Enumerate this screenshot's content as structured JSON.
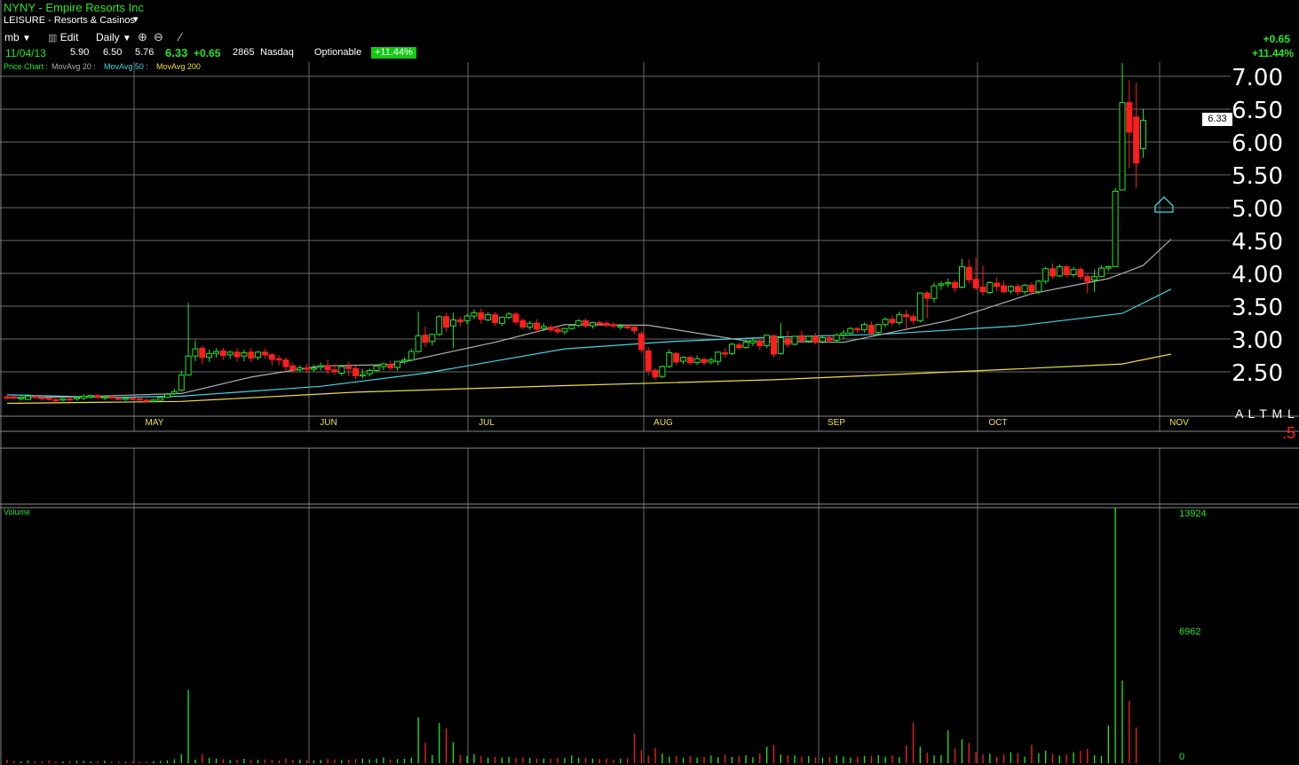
{
  "header": {
    "symbol_title": "NYNY - Empire Resorts Inc",
    "sector": "LEISURE - Resorts & Casinos",
    "sector_arrow": "▾",
    "toolbar": {
      "account": "mb",
      "edit": "Edit",
      "period": "Daily"
    },
    "quote": {
      "date": "11/04/13",
      "open": "5.90",
      "high": "6.50",
      "low": "5.76",
      "close": "6.33",
      "change": "+0.65",
      "volume": "2865",
      "exchange": "Nasdaq",
      "optionable": "Optionable",
      "pct_badge": "+11.44%"
    },
    "legend": {
      "price_chart": "Price Chart :",
      "ma20": "MovAvg 20 :",
      "ma50": "MovAvg 50 :",
      "ma200": "MovAvg 200"
    },
    "right_change": "+0.65",
    "right_pct": "+11.44%"
  },
  "side": {
    "price_tag": "6.33",
    "atml": "A L T M L",
    "point_five": ".5"
  },
  "volume_panel": {
    "label": "Volume"
  },
  "colors": {
    "up": "#22e822",
    "down": "#ff1e1e",
    "grid": "#6a6a6a",
    "ma20": "#b0b0b0",
    "ma50": "#3fd9e6",
    "ma200": "#f0e040",
    "month_label": "#f0e040",
    "volume_label": "#22e822"
  },
  "chart_data": {
    "type": "candlestick",
    "price_axis": {
      "ticks": [
        "7.00",
        "6.50",
        "6.00",
        "5.50",
        "5.00",
        "4.50",
        "4.00",
        "3.50",
        "3.00",
        "2.50"
      ],
      "ylim": [
        2.0,
        7.0
      ]
    },
    "x_axis": {
      "months": [
        "MAY",
        "JUN",
        "JUL",
        "AUG",
        "SEP",
        "OCT",
        "NOV"
      ]
    },
    "volume_axis": {
      "ticks": [
        "13924",
        "6962",
        "0"
      ],
      "ylim": [
        0,
        13924
      ]
    },
    "series": [
      {
        "name": "Price Chart",
        "kind": "candles"
      },
      {
        "name": "MovAvg 20",
        "kind": "line"
      },
      {
        "name": "MovAvg 50",
        "kind": "line"
      },
      {
        "name": "MovAvg 200",
        "kind": "line"
      }
    ],
    "candles": [
      [
        2.12,
        2.14,
        2.1,
        2.08
      ],
      [
        2.12,
        2.14,
        2.1,
        2.08
      ],
      [
        2.1,
        2.13,
        2.11,
        2.06
      ],
      [
        2.08,
        2.16,
        2.13,
        2.07
      ],
      [
        2.13,
        2.15,
        2.11,
        2.09
      ],
      [
        2.11,
        2.12,
        2.09,
        2.06
      ],
      [
        2.1,
        2.12,
        2.08,
        2.06
      ],
      [
        2.08,
        2.1,
        2.06,
        2.04
      ],
      [
        2.07,
        2.1,
        2.09,
        2.05
      ],
      [
        2.09,
        2.11,
        2.08,
        2.06
      ],
      [
        2.09,
        2.13,
        2.11,
        2.06
      ],
      [
        2.1,
        2.16,
        2.13,
        2.07
      ],
      [
        2.12,
        2.15,
        2.14,
        2.09
      ],
      [
        2.14,
        2.16,
        2.11,
        2.09
      ],
      [
        2.1,
        2.13,
        2.12,
        2.07
      ],
      [
        2.12,
        2.14,
        2.1,
        2.09
      ],
      [
        2.1,
        2.12,
        2.08,
        2.07
      ],
      [
        2.08,
        2.11,
        2.1,
        2.06
      ],
      [
        2.1,
        2.12,
        2.09,
        2.07
      ],
      [
        2.09,
        2.11,
        2.07,
        2.06
      ],
      [
        2.07,
        2.08,
        2.06,
        2.04
      ],
      [
        2.06,
        2.08,
        2.07,
        2.05
      ],
      [
        2.07,
        2.12,
        2.11,
        2.06
      ],
      [
        2.11,
        2.18,
        2.16,
        2.1
      ],
      [
        2.17,
        2.24,
        2.2,
        2.15
      ],
      [
        2.22,
        2.52,
        2.45,
        2.2
      ],
      [
        2.45,
        3.55,
        2.74,
        2.44
      ],
      [
        2.74,
        2.98,
        2.85,
        2.66
      ],
      [
        2.86,
        2.9,
        2.72,
        2.62
      ],
      [
        2.72,
        2.84,
        2.78,
        2.65
      ],
      [
        2.78,
        2.86,
        2.81,
        2.72
      ],
      [
        2.82,
        2.87,
        2.75,
        2.68
      ],
      [
        2.76,
        2.82,
        2.8,
        2.7
      ],
      [
        2.8,
        2.86,
        2.73,
        2.66
      ],
      [
        2.74,
        2.84,
        2.79,
        2.66
      ],
      [
        2.8,
        2.86,
        2.71,
        2.65
      ],
      [
        2.72,
        2.82,
        2.8,
        2.68
      ],
      [
        2.8,
        2.85,
        2.76,
        2.7
      ],
      [
        2.76,
        2.79,
        2.69,
        2.6
      ],
      [
        2.7,
        2.75,
        2.68,
        2.6
      ],
      [
        2.68,
        2.72,
        2.58,
        2.52
      ],
      [
        2.59,
        2.64,
        2.53,
        2.48
      ],
      [
        2.53,
        2.6,
        2.56,
        2.5
      ],
      [
        2.56,
        2.62,
        2.55,
        2.48
      ],
      [
        2.55,
        2.61,
        2.56,
        2.5
      ],
      [
        2.57,
        2.64,
        2.59,
        2.52
      ],
      [
        2.59,
        2.68,
        2.53,
        2.46
      ],
      [
        2.53,
        2.61,
        2.5,
        2.45
      ],
      [
        2.48,
        2.58,
        2.58,
        2.44
      ],
      [
        2.58,
        2.65,
        2.55,
        2.44
      ],
      [
        2.55,
        2.62,
        2.44,
        2.39
      ],
      [
        2.45,
        2.54,
        2.46,
        2.4
      ],
      [
        2.47,
        2.55,
        2.52,
        2.43
      ],
      [
        2.52,
        2.61,
        2.59,
        2.5
      ],
      [
        2.58,
        2.64,
        2.62,
        2.53
      ],
      [
        2.61,
        2.67,
        2.56,
        2.52
      ],
      [
        2.57,
        2.66,
        2.66,
        2.52
      ],
      [
        2.66,
        2.72,
        2.68,
        2.62
      ],
      [
        2.68,
        2.85,
        2.81,
        2.66
      ],
      [
        2.81,
        3.42,
        3.05,
        2.79
      ],
      [
        3.06,
        3.19,
        2.95,
        2.88
      ],
      [
        2.96,
        3.08,
        3.07,
        2.9
      ],
      [
        3.07,
        3.36,
        3.34,
        3.05
      ],
      [
        3.34,
        3.4,
        3.18,
        3.11
      ],
      [
        3.2,
        3.4,
        3.29,
        2.86
      ],
      [
        3.29,
        3.34,
        3.26,
        3.19
      ],
      [
        3.28,
        3.38,
        3.35,
        3.23
      ],
      [
        3.35,
        3.45,
        3.4,
        3.3
      ],
      [
        3.4,
        3.46,
        3.3,
        3.23
      ],
      [
        3.29,
        3.41,
        3.37,
        3.27
      ],
      [
        3.37,
        3.41,
        3.25,
        3.2
      ],
      [
        3.24,
        3.34,
        3.33,
        3.2
      ],
      [
        3.33,
        3.41,
        3.38,
        3.3
      ],
      [
        3.38,
        3.41,
        3.26,
        3.22
      ],
      [
        3.28,
        3.31,
        3.18,
        3.15
      ],
      [
        3.18,
        3.27,
        3.24,
        3.14
      ],
      [
        3.24,
        3.3,
        3.15,
        3.1
      ],
      [
        3.16,
        3.24,
        3.19,
        3.12
      ],
      [
        3.18,
        3.21,
        3.14,
        3.1
      ],
      [
        3.15,
        3.2,
        3.11,
        3.07
      ],
      [
        3.11,
        3.17,
        3.16,
        3.07
      ],
      [
        3.16,
        3.22,
        3.21,
        3.14
      ],
      [
        3.21,
        3.3,
        3.28,
        3.18
      ],
      [
        3.28,
        3.31,
        3.2,
        3.17
      ],
      [
        3.2,
        3.26,
        3.25,
        3.16
      ],
      [
        3.25,
        3.28,
        3.24,
        3.2
      ],
      [
        3.24,
        3.28,
        3.21,
        3.18
      ],
      [
        3.22,
        3.26,
        3.2,
        3.16
      ],
      [
        3.2,
        3.23,
        3.2,
        3.14
      ],
      [
        3.19,
        3.22,
        3.18,
        3.15
      ],
      [
        3.18,
        3.2,
        3.13,
        3.08
      ],
      [
        3.08,
        3.12,
        2.84,
        2.79
      ],
      [
        2.82,
        2.88,
        2.52,
        2.44
      ],
      [
        2.52,
        2.56,
        2.42,
        2.38
      ],
      [
        2.43,
        2.6,
        2.58,
        2.4
      ],
      [
        2.58,
        2.84,
        2.79,
        2.56
      ],
      [
        2.78,
        2.8,
        2.65,
        2.6
      ],
      [
        2.66,
        2.74,
        2.72,
        2.62
      ],
      [
        2.72,
        2.75,
        2.64,
        2.6
      ],
      [
        2.64,
        2.75,
        2.7,
        2.61
      ],
      [
        2.69,
        2.72,
        2.64,
        2.6
      ],
      [
        2.65,
        2.72,
        2.68,
        2.61
      ],
      [
        2.66,
        2.81,
        2.8,
        2.6
      ],
      [
        2.79,
        2.86,
        2.77,
        2.72
      ],
      [
        2.78,
        2.94,
        2.92,
        2.75
      ],
      [
        2.91,
        2.95,
        2.87,
        2.84
      ],
      [
        2.87,
        2.99,
        2.95,
        2.85
      ],
      [
        2.94,
        3.02,
        2.97,
        2.89
      ],
      [
        2.97,
        3.0,
        2.9,
        2.83
      ],
      [
        2.9,
        3.06,
        3.06,
        2.86
      ],
      [
        3.05,
        3.07,
        2.77,
        2.72
      ],
      [
        2.78,
        3.24,
        3.02,
        2.76
      ],
      [
        3.01,
        3.12,
        2.92,
        2.87
      ],
      [
        2.92,
        3.05,
        3.04,
        2.9
      ],
      [
        3.05,
        3.13,
        2.98,
        2.94
      ],
      [
        2.97,
        3.05,
        3.04,
        2.94
      ],
      [
        3.04,
        3.09,
        2.95,
        2.92
      ],
      [
        2.96,
        3.04,
        3.02,
        2.93
      ],
      [
        3.02,
        3.05,
        2.98,
        2.94
      ],
      [
        2.98,
        3.09,
        3.06,
        2.95
      ],
      [
        3.06,
        3.14,
        3.09,
        3.0
      ],
      [
        3.09,
        3.18,
        3.16,
        3.05
      ],
      [
        3.16,
        3.18,
        3.14,
        3.09
      ],
      [
        3.14,
        3.25,
        3.22,
        3.1
      ],
      [
        3.21,
        3.27,
        3.09,
        3.05
      ],
      [
        3.1,
        3.23,
        3.22,
        3.07
      ],
      [
        3.22,
        3.33,
        3.3,
        3.18
      ],
      [
        3.3,
        3.36,
        3.25,
        3.2
      ],
      [
        3.25,
        3.42,
        3.37,
        3.21
      ],
      [
        3.37,
        3.44,
        3.34,
        3.12
      ],
      [
        3.34,
        3.38,
        3.28,
        3.22
      ],
      [
        3.28,
        3.71,
        3.7,
        3.25
      ],
      [
        3.7,
        3.73,
        3.62,
        3.32
      ],
      [
        3.62,
        3.86,
        3.81,
        3.55
      ],
      [
        3.82,
        3.88,
        3.84,
        3.75
      ],
      [
        3.84,
        3.92,
        3.86,
        3.79
      ],
      [
        3.86,
        3.9,
        3.78,
        3.72
      ],
      [
        3.79,
        4.22,
        4.1,
        3.77
      ],
      [
        4.09,
        4.21,
        3.9,
        3.84
      ],
      [
        3.91,
        4.24,
        3.78,
        3.74
      ],
      [
        3.79,
        4.12,
        3.72,
        3.66
      ],
      [
        3.71,
        3.88,
        3.86,
        3.68
      ],
      [
        3.85,
        3.94,
        3.8,
        3.72
      ],
      [
        3.81,
        3.88,
        3.72,
        3.7
      ],
      [
        3.73,
        3.82,
        3.8,
        3.69
      ],
      [
        3.8,
        3.84,
        3.72,
        3.66
      ],
      [
        3.72,
        3.84,
        3.82,
        3.68
      ],
      [
        3.82,
        3.86,
        3.72,
        3.69
      ],
      [
        3.72,
        3.9,
        3.88,
        3.68
      ],
      [
        3.88,
        4.1,
        4.07,
        3.84
      ],
      [
        4.07,
        4.15,
        3.96,
        3.92
      ],
      [
        3.96,
        4.14,
        4.1,
        3.94
      ],
      [
        4.1,
        4.13,
        3.98,
        3.94
      ],
      [
        3.98,
        4.1,
        4.06,
        3.94
      ],
      [
        4.06,
        4.1,
        3.95,
        3.9
      ],
      [
        3.95,
        3.99,
        3.88,
        3.7
      ],
      [
        3.9,
        4.06,
        3.95,
        3.72
      ],
      [
        3.95,
        4.12,
        4.08,
        3.94
      ],
      [
        4.08,
        4.12,
        4.1,
        4.04
      ],
      [
        4.1,
        5.3,
        5.25,
        4.1
      ],
      [
        5.27,
        7.2,
        6.6,
        5.46
      ],
      [
        6.6,
        6.95,
        6.15,
        5.6
      ],
      [
        6.38,
        6.9,
        5.68,
        5.3
      ],
      [
        5.9,
        6.5,
        6.33,
        5.76
      ]
    ],
    "ma20": [
      [
        0,
        2.11
      ],
      [
        10,
        2.12
      ],
      [
        25,
        2.17
      ],
      [
        35,
        2.42
      ],
      [
        45,
        2.59
      ],
      [
        55,
        2.61
      ],
      [
        70,
        2.95
      ],
      [
        80,
        3.22
      ],
      [
        92,
        3.21
      ],
      [
        106,
        2.97
      ],
      [
        120,
        2.95
      ],
      [
        135,
        3.28
      ],
      [
        147,
        3.69
      ],
      [
        158,
        3.92
      ],
      [
        163,
        4.12
      ],
      [
        167,
        4.52
      ]
    ],
    "ma50": [
      [
        0,
        2.15
      ],
      [
        15,
        2.11
      ],
      [
        25,
        2.13
      ],
      [
        45,
        2.28
      ],
      [
        60,
        2.48
      ],
      [
        80,
        2.85
      ],
      [
        95,
        2.96
      ],
      [
        110,
        3.03
      ],
      [
        125,
        3.07
      ],
      [
        145,
        3.2
      ],
      [
        160,
        3.39
      ],
      [
        167,
        3.76
      ]
    ],
    "ma200": [
      [
        0,
        2.02
      ],
      [
        25,
        2.05
      ],
      [
        50,
        2.19
      ],
      [
        80,
        2.29
      ],
      [
        110,
        2.38
      ],
      [
        140,
        2.52
      ],
      [
        160,
        2.62
      ],
      [
        167,
        2.77
      ]
    ],
    "volumes": [
      200,
      120,
      90,
      150,
      110,
      90,
      140,
      110,
      90,
      100,
      130,
      120,
      90,
      110,
      140,
      100,
      90,
      80,
      110,
      90,
      80,
      110,
      130,
      160,
      220,
      500,
      4000,
      200,
      500,
      300,
      250,
      220,
      180,
      200,
      240,
      170,
      190,
      210,
      180,
      160,
      260,
      190,
      200,
      170,
      150,
      180,
      230,
      210,
      170,
      180,
      230,
      260,
      220,
      260,
      320,
      210,
      230,
      240,
      300,
      2500,
      1100,
      450,
      2200,
      1900,
      1150,
      450,
      400,
      500,
      380,
      300,
      350,
      310,
      340,
      280,
      330,
      300,
      250,
      260,
      240,
      290,
      280,
      420,
      300,
      280,
      250,
      230,
      260,
      210,
      250,
      270,
      1600,
      720,
      420,
      820,
      520,
      360,
      390,
      300,
      380,
      310,
      350,
      420,
      330,
      480,
      340,
      400,
      430,
      330,
      520,
      900,
      1000,
      480,
      420,
      430,
      350,
      380,
      320,
      300,
      340,
      420,
      360,
      300,
      350,
      400,
      380,
      440,
      350,
      420,
      330,
      960,
      2200,
      900,
      580,
      420,
      450,
      1800,
      800,
      1300,
      1100,
      630,
      480,
      520,
      340,
      480,
      600,
      540,
      360,
      1000,
      540,
      680,
      500,
      420,
      480,
      600,
      680,
      780,
      450,
      400,
      2050,
      13924,
      4500,
      3400,
      1950
    ]
  }
}
